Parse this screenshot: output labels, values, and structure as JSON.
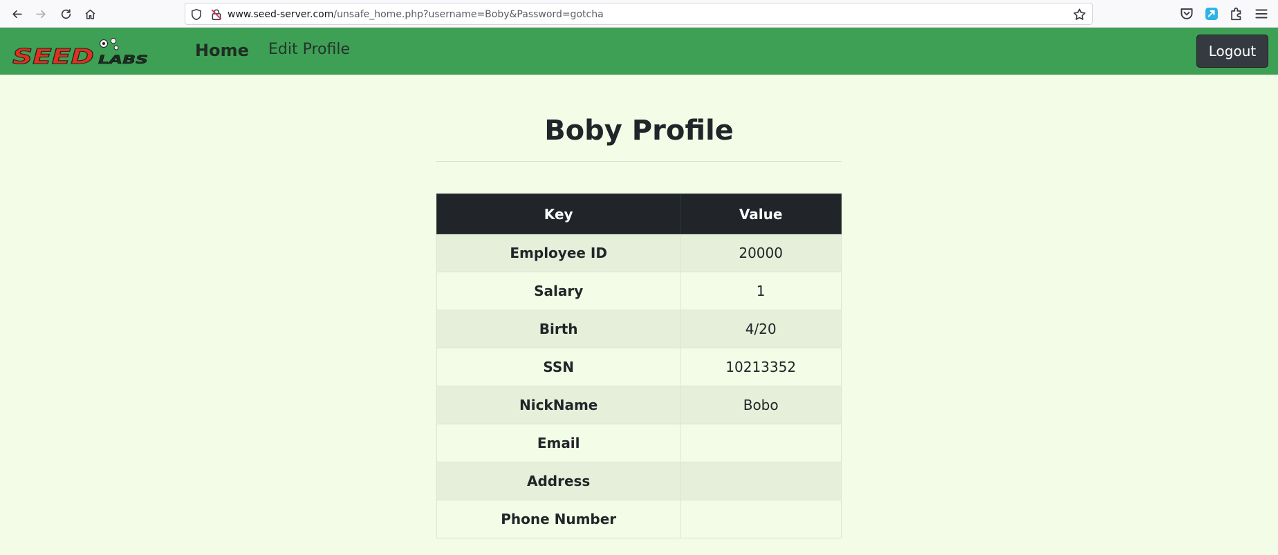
{
  "browser": {
    "url_host": "www.seed-server.com",
    "url_path": "/unsafe_home.php?username=Boby&Password=gotcha"
  },
  "navbar": {
    "logo_text": "SEED LABS",
    "home_label": "Home",
    "edit_profile_label": "Edit Profile",
    "logout_label": "Logout"
  },
  "profile": {
    "title": "Boby Profile",
    "columns": [
      "Key",
      "Value"
    ],
    "rows": [
      {
        "key": "Employee ID",
        "value": "20000"
      },
      {
        "key": "Salary",
        "value": "1"
      },
      {
        "key": "Birth",
        "value": "4/20"
      },
      {
        "key": "SSN",
        "value": "10213352"
      },
      {
        "key": "NickName",
        "value": "Bobo"
      },
      {
        "key": "Email",
        "value": ""
      },
      {
        "key": "Address",
        "value": ""
      },
      {
        "key": "Phone Number",
        "value": ""
      }
    ]
  },
  "colors": {
    "navbar_bg": "#3ea055",
    "page_bg": "#f3fce6",
    "table_header_bg": "#212529",
    "logout_bg": "#343a40"
  }
}
